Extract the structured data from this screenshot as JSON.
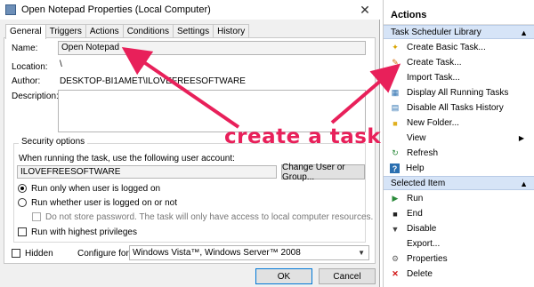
{
  "dialog": {
    "title": "Open Notepad Properties (Local Computer)",
    "close": "✕",
    "tabs": [
      "General",
      "Triggers",
      "Actions",
      "Conditions",
      "Settings",
      "History"
    ],
    "name_label": "Name:",
    "name_value": "Open Notepad",
    "location_label": "Location:",
    "location_value": "\\",
    "author_label": "Author:",
    "author_value": "DESKTOP-BI1AMET\\ILOVEFREESOFTWARE",
    "description_label": "Description:",
    "security_title": "Security options",
    "security_text": "When running the task, use the following user account:",
    "user_value": "ILOVEFREESOFTWARE",
    "change_user_button": "Change User or Group...",
    "radio_logged_on": "Run only when user is logged on",
    "radio_whether": "Run whether user is logged on or not",
    "no_store_password": "Do not store password.  The task will only have access to local computer resources.",
    "highest_privileges": "Run with highest privileges",
    "hidden_label": "Hidden",
    "configure_label": "Configure for:",
    "configure_value": "Windows Vista™, Windows Server™ 2008",
    "ok": "OK",
    "cancel": "Cancel"
  },
  "actions_pane": {
    "title": "Actions",
    "library_header": "Task Scheduler Library",
    "library_items": [
      {
        "label": "Create Basic Task...",
        "icon": "create-basic-task-icon"
      },
      {
        "label": "Create Task...",
        "icon": "create-task-icon"
      },
      {
        "label": "Import Task...",
        "icon": "import-task-icon"
      },
      {
        "label": "Display All Running Tasks",
        "icon": "running-tasks-icon"
      },
      {
        "label": "Disable All Tasks History",
        "icon": "history-icon"
      },
      {
        "label": "New Folder...",
        "icon": "folder-icon"
      },
      {
        "label": "View",
        "icon": "view-icon"
      },
      {
        "label": "Refresh",
        "icon": "refresh-icon"
      },
      {
        "label": "Help",
        "icon": "help-icon"
      }
    ],
    "selected_header": "Selected Item",
    "selected_items": [
      {
        "label": "Run",
        "icon": "run-icon"
      },
      {
        "label": "End",
        "icon": "end-icon"
      },
      {
        "label": "Disable",
        "icon": "disable-icon"
      },
      {
        "label": "Export...",
        "icon": "export-icon"
      },
      {
        "label": "Properties",
        "icon": "properties-icon"
      },
      {
        "label": "Delete",
        "icon": "delete-icon"
      }
    ]
  },
  "annotation": {
    "text": "create a task",
    "color": "#e8205a"
  }
}
